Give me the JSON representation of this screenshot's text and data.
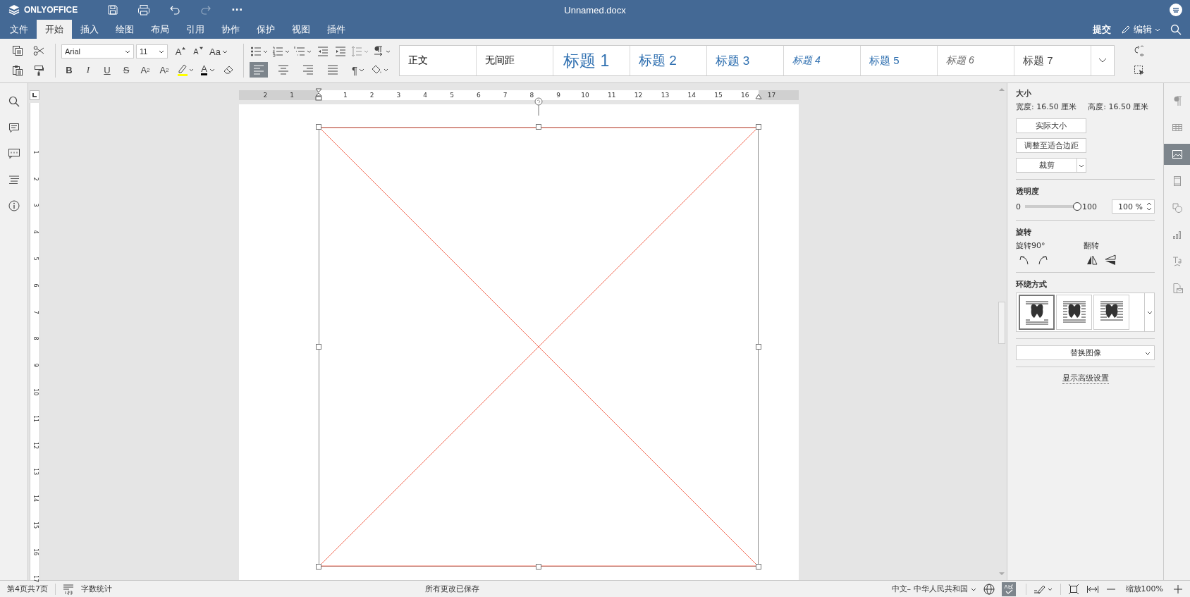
{
  "app": {
    "logo": "ONLYOFFICE",
    "more": "···"
  },
  "window": {
    "title": "Unnamed.docx"
  },
  "menu_tabs": [
    {
      "label": "文件",
      "selected": false
    },
    {
      "label": "开始",
      "selected": true
    },
    {
      "label": "插入",
      "selected": false
    },
    {
      "label": "绘图",
      "selected": false
    },
    {
      "label": "布局",
      "selected": false
    },
    {
      "label": "引用",
      "selected": false
    },
    {
      "label": "协作",
      "selected": false
    },
    {
      "label": "保护",
      "selected": false
    },
    {
      "label": "视图",
      "selected": false
    },
    {
      "label": "插件",
      "selected": false
    }
  ],
  "header_right": {
    "submit": "提交",
    "edit": "编辑"
  },
  "toolbar": {
    "font": "Arial",
    "size": "11",
    "size_buttons": [
      {
        "glyph": "A",
        "kind": "grow"
      },
      {
        "glyph": "A",
        "kind": "shrink"
      },
      {
        "glyph": "Aa",
        "kind": "case"
      }
    ],
    "format_buttons": [
      {
        "glyph": "B",
        "kind": "bold"
      },
      {
        "glyph": "I",
        "kind": "italic"
      },
      {
        "glyph": "U",
        "kind": "underline"
      },
      {
        "glyph": "S",
        "kind": "strike"
      },
      {
        "glyph": "A",
        "kind": "superscript",
        "index": "2"
      },
      {
        "glyph": "A",
        "kind": "subscript",
        "index": "2"
      }
    ],
    "font_color": "A",
    "pilcrow": "¶",
    "align": [
      {
        "kind": "left",
        "selected": true
      },
      {
        "kind": "center",
        "selected": false
      },
      {
        "kind": "right",
        "selected": false
      },
      {
        "kind": "justify",
        "selected": false
      }
    ]
  },
  "styles": [
    {
      "label": "正文",
      "kind": "normal"
    },
    {
      "label": "无间距",
      "kind": "normal"
    },
    {
      "label": "标题 1",
      "kind": "h1"
    },
    {
      "label": "标题 2",
      "kind": "h2"
    },
    {
      "label": "标题 3",
      "kind": "h3"
    },
    {
      "label": "标题 4",
      "kind": "h4"
    },
    {
      "label": "标题 5",
      "kind": "h5"
    },
    {
      "label": "标题 6",
      "kind": "h6"
    },
    {
      "label": "标题 7",
      "kind": "h7"
    }
  ],
  "ruler": {
    "labels": [
      "2",
      "1",
      "1",
      "2",
      "3",
      "4",
      "5",
      "6",
      "7",
      "8",
      "9",
      "10",
      "11",
      "12",
      "13",
      "14",
      "15",
      "16",
      "17"
    ]
  },
  "vertical_ruler": {
    "labels": [
      "1",
      "2",
      "3",
      "4",
      "5",
      "6",
      "7",
      "8",
      "9",
      "10",
      "11",
      "12",
      "13",
      "14",
      "15",
      "16",
      "17"
    ]
  },
  "panel": {
    "size_title": "大小",
    "width": "宽度: 16.50 厘米",
    "height": "高度: 16.50 厘米",
    "buttons": [
      "实际大小",
      "调整至适合边距"
    ],
    "crop": "裁剪",
    "opacity_title": "透明度",
    "slider_min": "0",
    "slider_max": "100",
    "level": 1,
    "opacity_value": "100 %",
    "rotation_title": "旋转",
    "rotate90": "旋转90°",
    "flip": "翻转",
    "wrap_title": "环绕方式",
    "wrap_styles": [
      {
        "kind": "inline",
        "selected": true
      },
      {
        "kind": "square",
        "selected": false
      },
      {
        "kind": "tight",
        "selected": false
      }
    ],
    "replace": "替换图像",
    "advanced": "显示高级设置"
  },
  "right_tabs": [
    {
      "kind": "paragraph",
      "selected": false
    },
    {
      "kind": "table",
      "selected": false
    },
    {
      "kind": "image",
      "selected": true
    },
    {
      "kind": "header",
      "selected": false
    },
    {
      "kind": "shape",
      "selected": false
    },
    {
      "kind": "chart",
      "selected": false
    },
    {
      "kind": "textart",
      "selected": false
    },
    {
      "kind": "mailmerge",
      "selected": false
    }
  ],
  "status_bar": {
    "page": "第4页共7页",
    "word_count": "字数统计",
    "saved": "所有更改已保存",
    "language": "中文– 中华人民共和国",
    "zoom": "缩放100%"
  }
}
